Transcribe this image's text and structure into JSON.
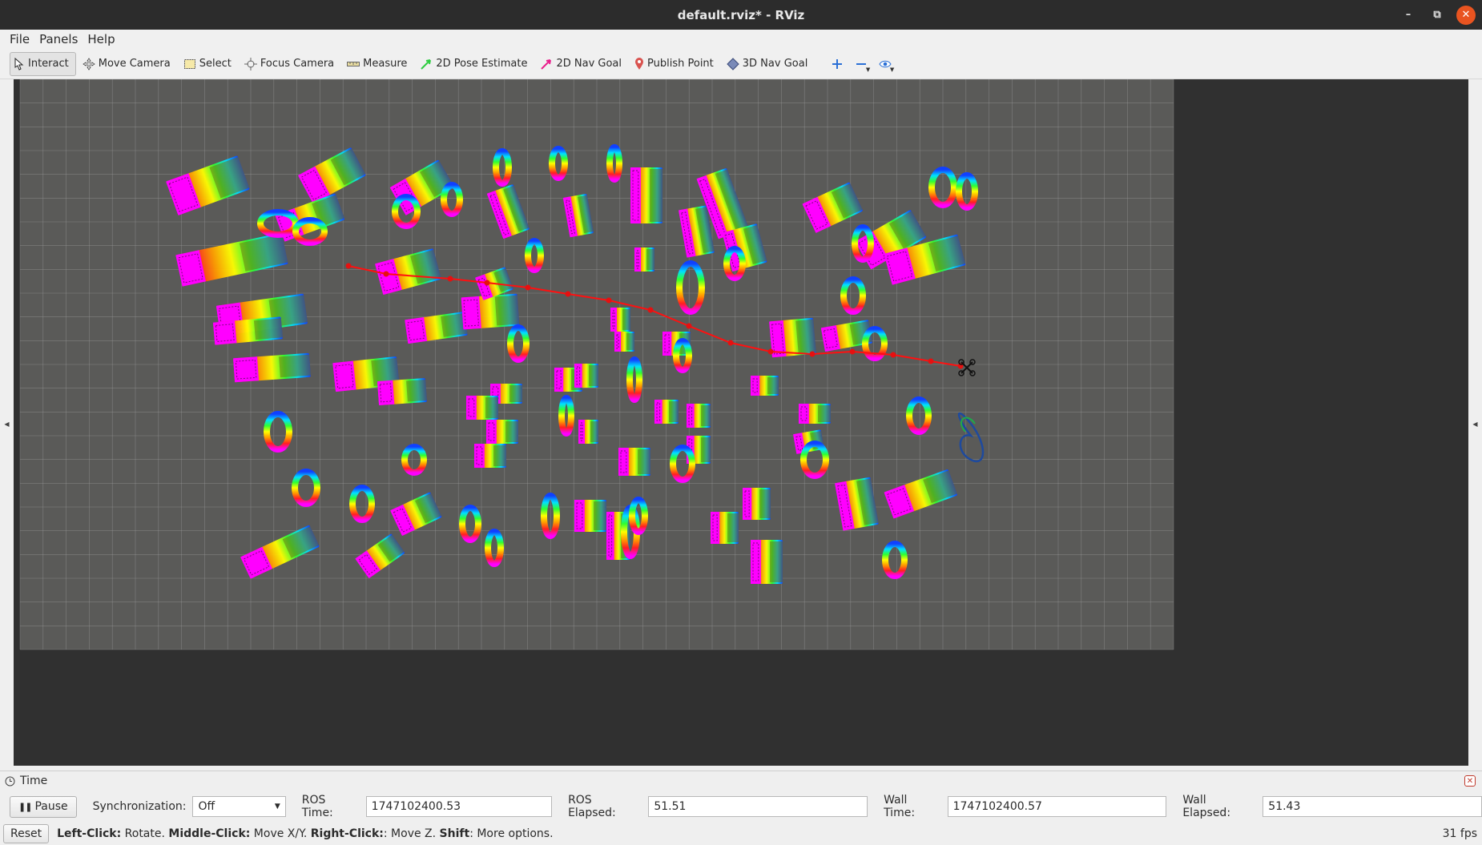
{
  "window": {
    "title": "default.rviz* - RViz"
  },
  "menu": [
    {
      "label": "File"
    },
    {
      "label": "Panels"
    },
    {
      "label": "Help"
    }
  ],
  "toolbar": {
    "tools": [
      {
        "label": "Interact",
        "icon": "cursor-icon",
        "active": true
      },
      {
        "label": "Move Camera",
        "icon": "move-camera-icon"
      },
      {
        "label": "Select",
        "icon": "select-box-icon"
      },
      {
        "label": "Focus Camera",
        "icon": "focus-camera-icon"
      },
      {
        "label": "Measure",
        "icon": "ruler-icon"
      },
      {
        "label": "2D Pose Estimate",
        "icon": "pose-arrow-icon",
        "color": "#2ecc40"
      },
      {
        "label": "2D Nav Goal",
        "icon": "goal-arrow-icon",
        "color": "#e91e8c"
      },
      {
        "label": "Publish Point",
        "icon": "map-pin-icon",
        "color": "#d9534f"
      },
      {
        "label": "3D Nav Goal",
        "icon": "diamond-icon",
        "color": "#4a5a8a"
      }
    ],
    "icon_buttons": [
      "plus-icon",
      "minus-icon",
      "eye-icon"
    ]
  },
  "viewport": {
    "background": "#303030",
    "grid_color": "#a0a0a0",
    "path_color": "#ff1010",
    "palette": [
      "#ff00ff",
      "#ff2020",
      "#ff9a00",
      "#ffff00",
      "#30ff30",
      "#00e0ff",
      "#1040ff"
    ]
  },
  "time_panel": {
    "title": "Time",
    "pause_label": "Pause",
    "sync_label": "Synchronization:",
    "sync_value": "Off",
    "ros_time_label": "ROS Time:",
    "ros_time_value": "1747102400.53",
    "ros_elapsed_label": "ROS Elapsed:",
    "ros_elapsed_value": "51.51",
    "wall_time_label": "Wall Time:",
    "wall_time_value": "1747102400.57",
    "wall_elapsed_label": "Wall Elapsed:",
    "wall_elapsed_value": "51.43"
  },
  "status": {
    "reset_label": "Reset",
    "hints": [
      {
        "key": "Left-Click:",
        "text": " Rotate. "
      },
      {
        "key": "Middle-Click:",
        "text": " Move X/Y. "
      },
      {
        "key": "Right-Click:",
        "text": ": Move Z. "
      },
      {
        "key": "Shift",
        "text": ": More options."
      }
    ],
    "fps": "31 fps"
  }
}
